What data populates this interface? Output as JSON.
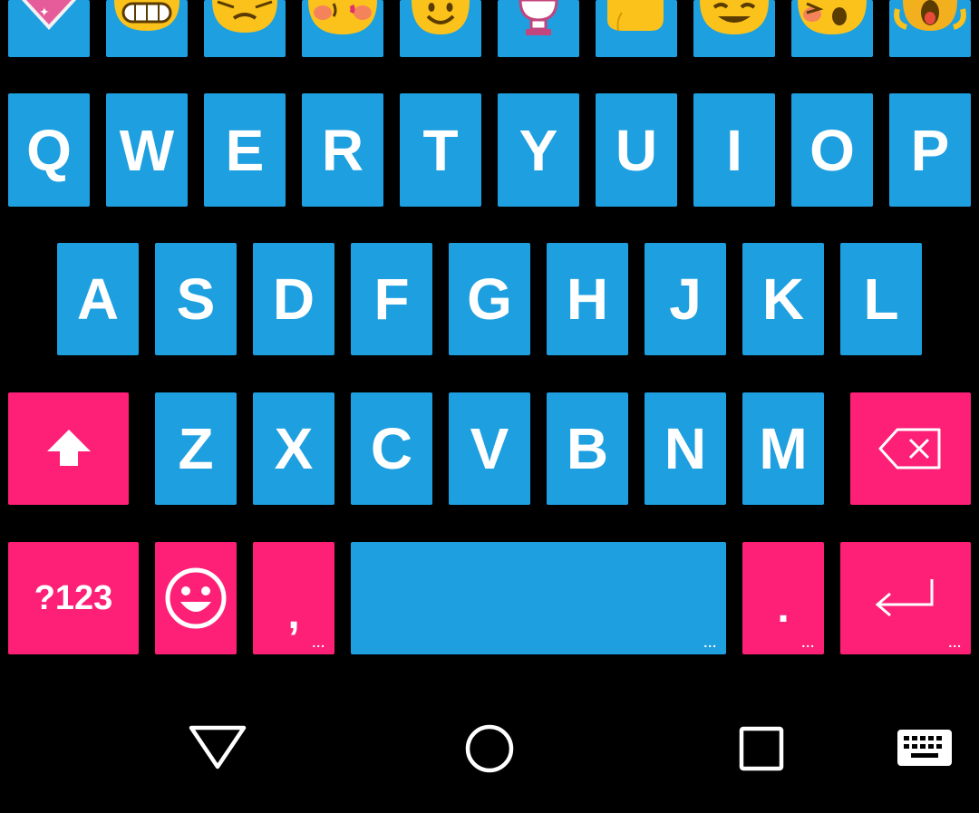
{
  "emoji_row": [
    {
      "name": "sparkling-heart-emoji-icon"
    },
    {
      "name": "grimacing-face-emoji-icon"
    },
    {
      "name": "unamused-face-emoji-icon"
    },
    {
      "name": "kissing-face-emoji-icon"
    },
    {
      "name": "smiling-face-emoji-icon"
    },
    {
      "name": "crystal-ball-emoji-icon"
    },
    {
      "name": "raised-hand-emoji-icon"
    },
    {
      "name": "grinning-face-emoji-icon"
    },
    {
      "name": "confounded-face-emoji-icon"
    },
    {
      "name": "screaming-face-emoji-icon"
    }
  ],
  "row1": [
    "Q",
    "W",
    "E",
    "R",
    "T",
    "Y",
    "U",
    "I",
    "O",
    "P"
  ],
  "row2": [
    "A",
    "S",
    "D",
    "F",
    "G",
    "H",
    "J",
    "K",
    "L"
  ],
  "row3": [
    "Z",
    "X",
    "C",
    "V",
    "B",
    "N",
    "M"
  ],
  "bottom": {
    "symbols_label": "?123",
    "comma_label": ",",
    "period_label": ".",
    "more_indicator": "..."
  },
  "colors": {
    "key_blue": "#1e9fe0",
    "key_pink": "#fe1f77",
    "background": "#000000"
  },
  "icons": {
    "shift": "shift-icon",
    "delete": "backspace-icon",
    "emoji": "smiley-icon",
    "enter": "enter-icon",
    "back": "back-triangle-icon",
    "home": "home-circle-icon",
    "recents": "recents-square-icon",
    "keyboard": "keyboard-icon"
  }
}
